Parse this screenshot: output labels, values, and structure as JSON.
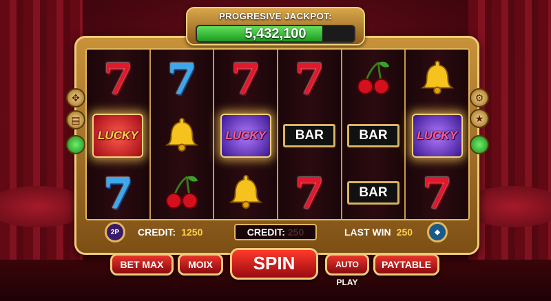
{
  "jackpot": {
    "label": "PROGRESIVE JACKPOT:",
    "value": "5,432,100",
    "progress": 0.8
  },
  "reels": [
    [
      "seven-red",
      "lucky-red",
      "seven-blue"
    ],
    [
      "seven-blue",
      "bell",
      "cherries"
    ],
    [
      "seven-red",
      "lucky-blue",
      "bell"
    ],
    [
      "seven-red",
      "bar",
      "seven-red"
    ],
    [
      "cherries",
      "bar",
      "bar"
    ],
    [
      "bell",
      "lucky-blue",
      "seven-red"
    ]
  ],
  "symbols": {
    "bar_text": "BAR",
    "lucky_text": "LUCKY",
    "seven_text": "7"
  },
  "info": {
    "credit_label": "CREDIT:",
    "credit_value": "1250",
    "credit_box_label": "CREDIT:",
    "credit_box_value": "250",
    "last_win_label": "LAST WIN",
    "last_win_value": "250",
    "left_chip": "2P"
  },
  "buttons": {
    "bet_max": "BET MAX",
    "moix": "MOIX",
    "spin": "SPIN",
    "auto_play": "AUTO PLAY",
    "paytable": "PAYTABLE"
  },
  "colors": {
    "accent_gold": "#e3b75d",
    "button_red": "#c81c22",
    "jackpot_green": "#3cc23a"
  }
}
